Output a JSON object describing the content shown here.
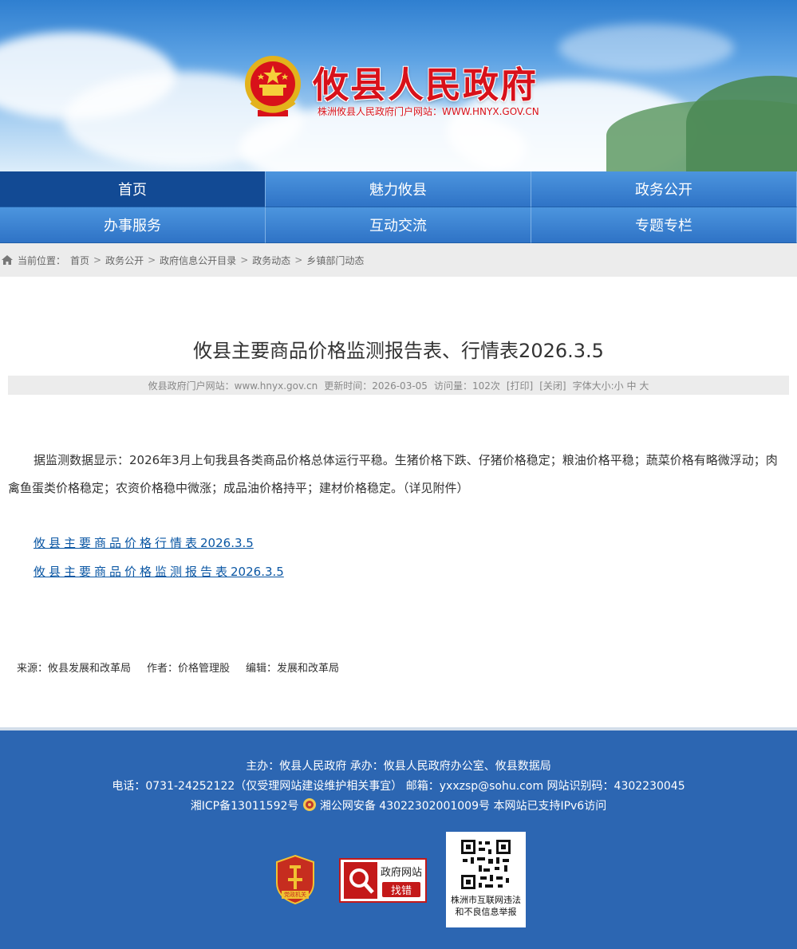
{
  "header": {
    "title": "攸县人民政府",
    "subtitle": "株洲攸县人民政府门户网站：WWW.HNYX.GOV.CN"
  },
  "nav": {
    "items": [
      {
        "label": "首页",
        "active": true
      },
      {
        "label": "魅力攸县"
      },
      {
        "label": "政务公开"
      },
      {
        "label": "办事服务"
      },
      {
        "label": "互动交流"
      },
      {
        "label": "专题专栏"
      }
    ]
  },
  "breadcrumb": {
    "prefix": "当前位置：",
    "items": [
      "首页",
      "政务公开",
      "政府信息公开目录",
      "政务动态",
      "乡镇部门动态"
    ],
    "separator": ">"
  },
  "article": {
    "title": "攸县主要商品价格监测报告表、行情表2026.3.5",
    "meta": {
      "site": "攸县政府门户网站：www.hnyx.gov.cn",
      "updated": "更新时间：2026-03-05",
      "visits": "访问量：102次",
      "print": "[打印]",
      "close": "[关闭]",
      "font_label": "字体大小:",
      "font_small": "小",
      "font_medium": "中",
      "font_large": "大"
    },
    "body": "据监测数据显示：2026年3月上旬我县各类商品价格总体运行平稳。生猪价格下跌、仔猪价格稳定；粮油价格平稳；蔬菜价格有略微浮动；肉禽鱼蛋类价格稳定；农资价格稳中微涨；成品油价格持平；建材价格稳定。（详见附件）",
    "attachments": [
      {
        "text": "攸县主要商品价格行情表",
        "num": "2026.3.5"
      },
      {
        "text": "攸县主要商品价格监测报告表",
        "num": "2026.3.5"
      }
    ],
    "source": "来源：攸县发展和改革局",
    "author": "作者：价格管理股",
    "editor": "编辑：发展和改革局"
  },
  "footer": {
    "line1": "主办：攸县人民政府 承办：攸县人民政府办公室、攸县数据局",
    "line2": "电话：0731-24252122（仅受理网站建设维护相关事宜） 邮箱：yxxzsp@sohu.com 网站识别码：4302230045",
    "icp": "湘ICP备13011592号",
    "police": "湘公网安备 43022302001009号",
    "ipv6": "本网站已支持IPv6访问",
    "party_badge": "党政机关",
    "findbug_title": "政府网站",
    "findbug_action": "找错",
    "qr_caption1": "株洲市互联网违法",
    "qr_caption2": "和不良信息举报"
  },
  "colors": {
    "title_red": "#d8111a",
    "nav_blue": "#2f73c6",
    "nav_active": "#124a94",
    "footer_blue": "#2c66b2",
    "link_blue": "#0b57a4"
  },
  "icons": [
    "national-emblem-icon",
    "home-icon",
    "police-badge-icon",
    "party-badge-icon",
    "magnifier-icon",
    "qr-code-icon"
  ]
}
